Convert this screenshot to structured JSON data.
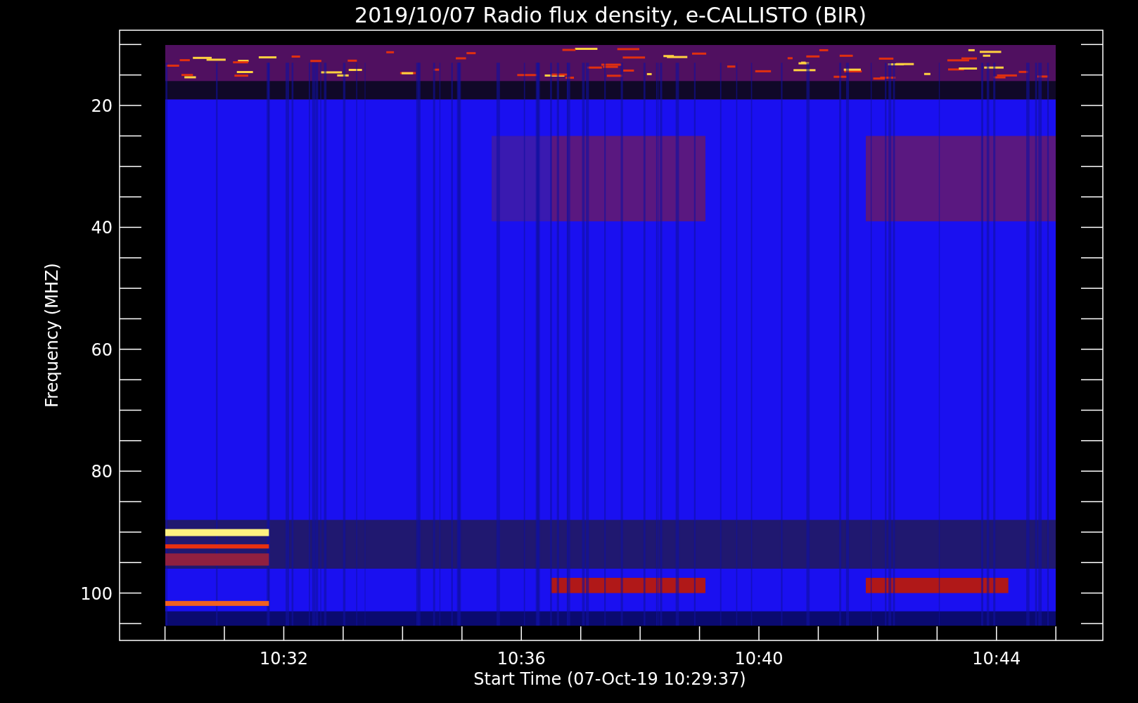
{
  "title": "2019/10/07  Radio flux density, e-CALLISTO (BIR)",
  "y_axis": {
    "label": "Frequency (MHZ)",
    "ticks": [
      "20",
      "40",
      "60",
      "80",
      "100"
    ]
  },
  "x_axis": {
    "label": "Start Time (07-Oct-19 10:29:37)",
    "ticks": [
      "10:32",
      "10:36",
      "10:40",
      "10:44"
    ]
  }
}
